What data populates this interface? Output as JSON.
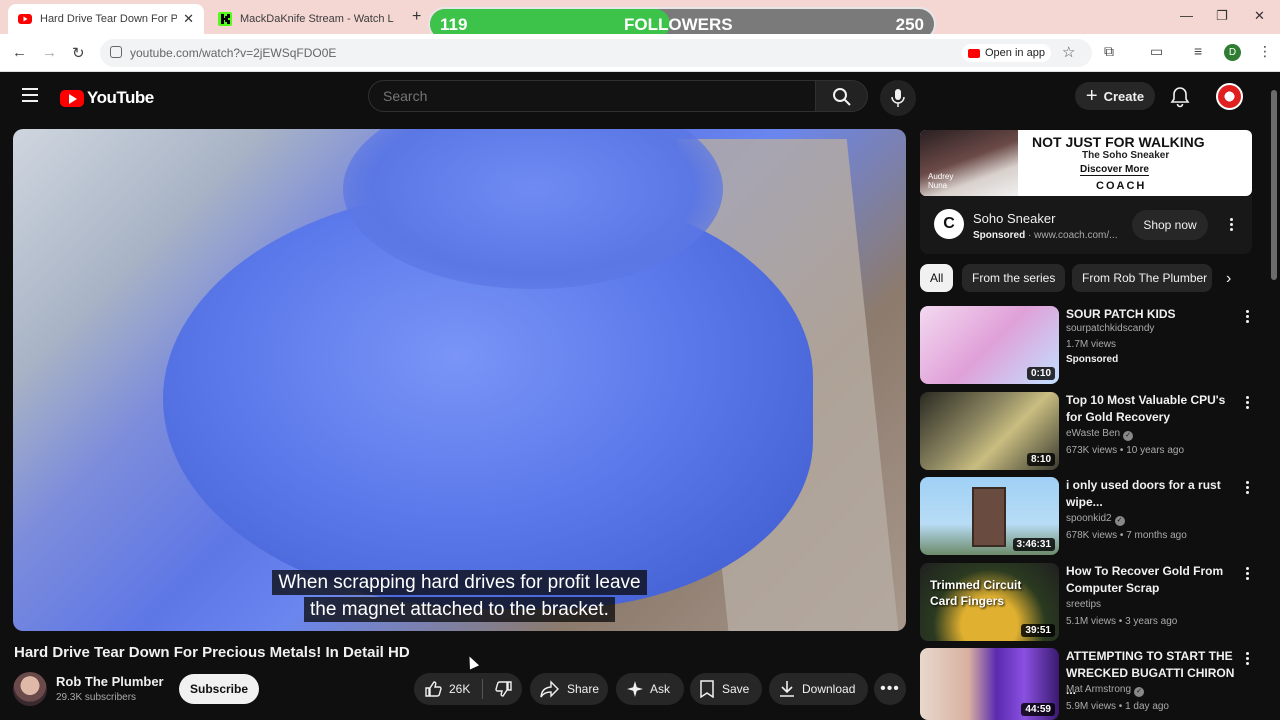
{
  "browser": {
    "tabs": [
      {
        "title": "Hard Drive Tear Down For Precious Metals! In Detail HD",
        "active": true
      },
      {
        "title": "MackDaKnife Stream - Watch Live",
        "active": false
      }
    ],
    "url": "youtube.com/watch?v=2jEWSqFDO0E",
    "open_in_app": "Open in app",
    "profile_initial": "D"
  },
  "followers_overlay": {
    "current": "119",
    "label": "FOLLOWERS",
    "goal": "250",
    "progress_fraction": 0.476
  },
  "header": {
    "logo_text": "YouTube",
    "search_placeholder": "Search",
    "create_label": "Create"
  },
  "video": {
    "caption_line1": "When scrapping hard drives for profit leave",
    "caption_line2": "the magnet attached to the bracket.",
    "title": "Hard Drive Tear Down For Precious Metals! In Detail HD",
    "channel": "Rob The Plumber",
    "subscribers": "29.3K subscribers",
    "subscribe_label": "Subscribe",
    "likes": "26K",
    "share_label": "Share",
    "ask_label": "Ask",
    "save_label": "Save",
    "download_label": "Download"
  },
  "sidebar": {
    "ad_banner": {
      "headline": "NOT JUST FOR WALKING",
      "subhead": "The Soho Sneaker",
      "cta": "Discover More",
      "brand": "COACH",
      "model_name": "Audrey\nNuna"
    },
    "ad_card": {
      "logo_letter": "C",
      "name": "Soho Sneaker",
      "sponsored": "Sponsored",
      "domain": "www.coach.com/...",
      "button": "Shop now"
    },
    "chips": [
      "All",
      "From the series",
      "From Rob The Plumber"
    ],
    "recommendations": [
      {
        "title": "SOUR PATCH KIDS",
        "channel": "sourpatchkidscandy",
        "meta": "1.7M views",
        "sponsored": "Sponsored",
        "duration": "0:10",
        "verified": false
      },
      {
        "title": "Top 10 Most Valuable CPU's for Gold Recovery",
        "channel": "eWaste Ben",
        "meta": "673K views • 10 years ago",
        "duration": "8:10",
        "verified": true
      },
      {
        "title": "i only used doors for a rust wipe...",
        "channel": "spoonkid2",
        "meta": "678K views • 7 months ago",
        "duration": "3:46:31",
        "verified": true
      },
      {
        "title": "How To Recover Gold From Computer Scrap",
        "channel": "sreetips",
        "meta": "5.1M views • 3 years ago",
        "duration": "39:51",
        "verified": false,
        "thumb_text": "Trimmed Circuit\nCard Fingers"
      },
      {
        "title": "ATTEMPTING TO START THE WRECKED BUGATTI CHIRON ...",
        "channel": "Mat Armstrong",
        "meta": "5.9M views • 1 day ago",
        "duration": "44:59",
        "verified": true
      }
    ]
  },
  "colors": {
    "yt_red": "#ff0000",
    "bg": "#0f0f0f",
    "progress_green": "#3ec34a",
    "tabbar": "#f4d6d3"
  },
  "icons": [
    "menu-icon",
    "search-icon",
    "mic-icon",
    "bell-icon",
    "like-icon",
    "dislike-icon",
    "share-icon",
    "sparkle-icon",
    "bookmark-icon",
    "download-icon",
    "more-icon",
    "chevron-right-icon"
  ]
}
